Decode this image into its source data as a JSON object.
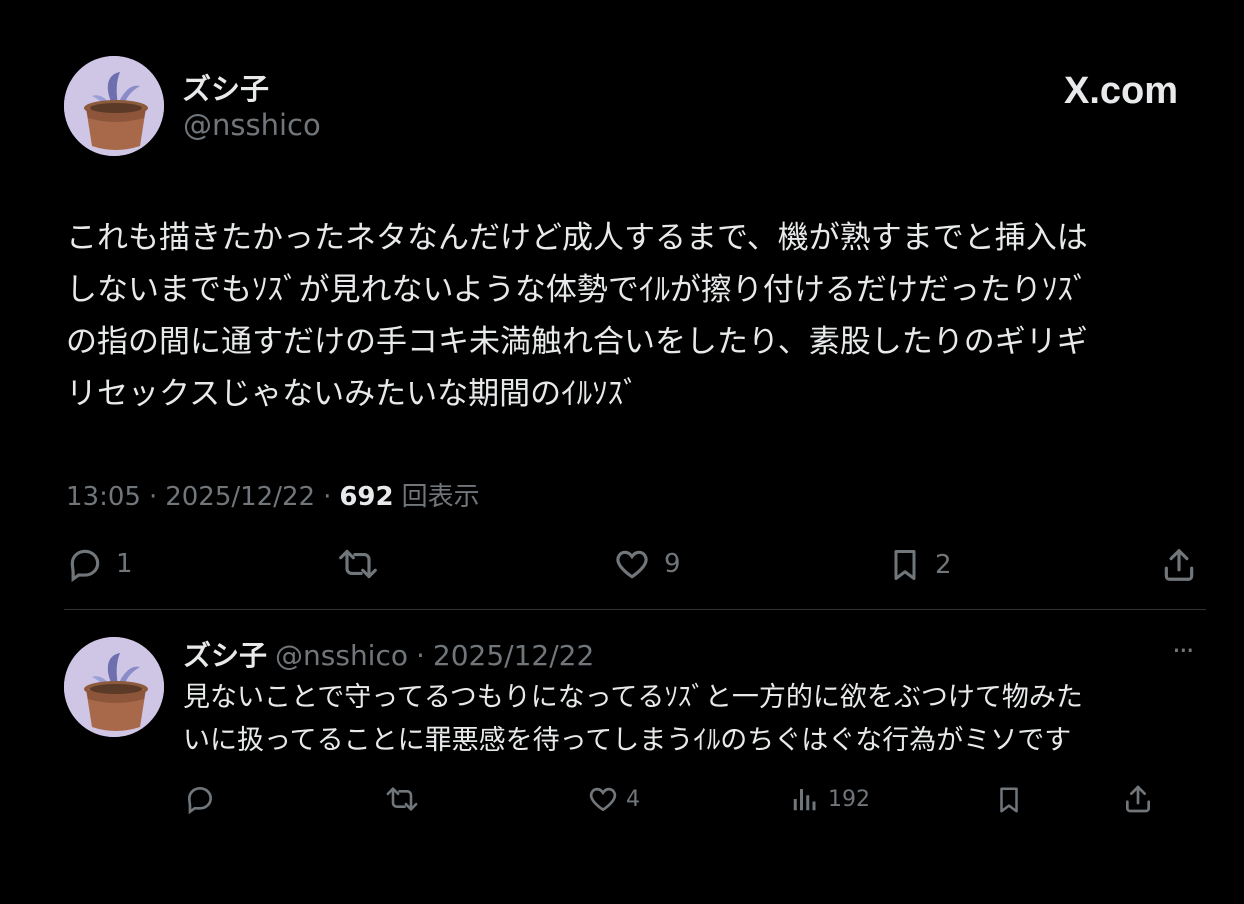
{
  "header": {
    "display_name": "ズシ子",
    "handle": "@nsshico",
    "watermark": "X.com"
  },
  "tweet": {
    "text_lines": [
      "これも描きたかったネタなんだけど成人するまで、機が熟すまでと挿入は",
      "しないまでもｿｽﾞが見れないような体勢でｲﾙが擦り付けるだけだったりｿｽﾞ",
      "の指の間に通すだけの手コキ未満触れ合いをしたり、素股したりのギリギ",
      "リセックスじゃないみたいな期間のｲﾙｿｽﾞ"
    ],
    "time": "13:05",
    "date": "2025/12/22",
    "views": "692",
    "views_label": "回表示",
    "separator": "·"
  },
  "actions": {
    "replies": "1",
    "retweets": "",
    "likes": "9",
    "bookmarks": "2"
  },
  "reply": {
    "display_name": "ズシ子",
    "handle": "@nsshico",
    "date": "2025/12/22",
    "separator": "·",
    "text_lines": [
      "見ないことで守ってるつもりになってるｿｽﾞと一方的に欲をぶつけて物みた",
      "いに扱ってることに罪悪感を待ってしまうｲﾙのちぐはぐな行為がミソです"
    ],
    "more": "···",
    "actions": {
      "replies": "",
      "retweets": "",
      "likes": "4",
      "views": "192"
    }
  },
  "colors": {
    "background": "#000000",
    "text": "#e7e9ea",
    "muted": "#71767b",
    "divider": "#2f3336",
    "avatar_bg": "#cfc6e6"
  },
  "icons": [
    "pot-plant-avatar",
    "reply-icon",
    "retweet-icon",
    "heart-icon",
    "bookmark-icon",
    "share-icon",
    "views-icon",
    "more-icon"
  ]
}
